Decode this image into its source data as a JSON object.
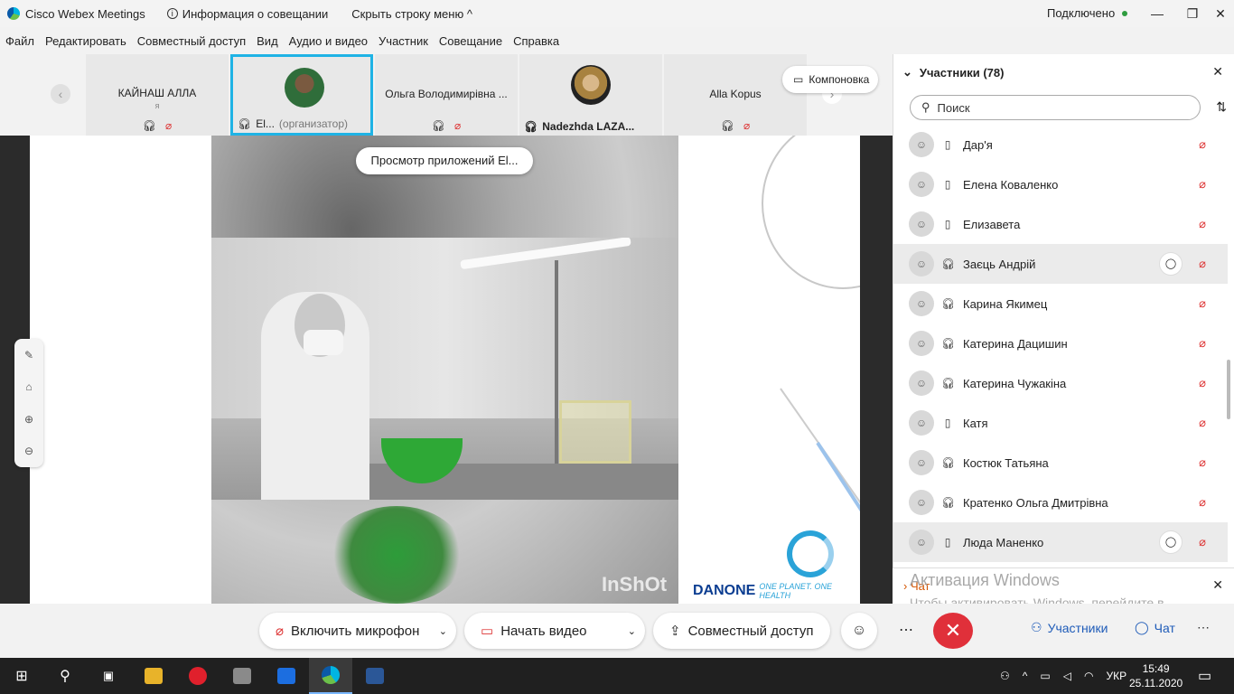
{
  "app": {
    "title": "Cisco Webex Meetings",
    "meeting_info": "Информация о совещании",
    "hide_menu": "Скрыть строку меню ^",
    "status": "Подключено"
  },
  "window_controls": {
    "minimize": "—",
    "restore": "❐",
    "close": "✕"
  },
  "menu": [
    "Файл",
    "Редактировать",
    "Совместный доступ",
    "Вид",
    "Аудио и видео",
    "Участник",
    "Совещание",
    "Справка"
  ],
  "strip": {
    "tiles": [
      {
        "name": "КАЙНАШ АЛЛА",
        "sub": "я"
      },
      {
        "name": "El...",
        "role": "(организатор)"
      },
      {
        "name": "Ольга Володимирівна ..."
      },
      {
        "name": "Nadezhda LAZA..."
      },
      {
        "name": "Alla Kopus"
      }
    ],
    "layout_label": "Компоновка"
  },
  "share": {
    "preview_label": "Просмотр приложений El...",
    "watermark": "InShOt",
    "brand": "DANONE",
    "tagline": "ONE PLANET. ONE HEALTH"
  },
  "participants": {
    "title": "Участники (78)",
    "search_placeholder": "Поиск",
    "list": [
      {
        "name": "Дар'я",
        "device": "phone",
        "chat": false
      },
      {
        "name": "Елена Коваленко",
        "device": "phone",
        "chat": false
      },
      {
        "name": "Елизавета",
        "device": "phone",
        "chat": false
      },
      {
        "name": "Заєць Андрій",
        "device": "headset",
        "chat": true
      },
      {
        "name": "Карина Якимец",
        "device": "headset",
        "chat": false
      },
      {
        "name": "Катерина Дацишин",
        "device": "headset",
        "chat": false
      },
      {
        "name": "Катерина Чужакіна",
        "device": "headset",
        "chat": false
      },
      {
        "name": "Катя",
        "device": "phone",
        "chat": false
      },
      {
        "name": "Костюк Татьяна",
        "device": "headset",
        "chat": false
      },
      {
        "name": "Кратенко Ольга Дмитрівна",
        "device": "headset",
        "chat": false
      },
      {
        "name": "Люда Маненко",
        "device": "phone",
        "chat": true
      }
    ]
  },
  "chat_panel": {
    "label": "Чат"
  },
  "activation": {
    "title": "Активация Windows",
    "text": "Чтобы активировать Windows, перейдите в раздел \"Параметры\"."
  },
  "controls": {
    "mic": "Включить микрофон",
    "video": "Начать видео",
    "share": "Совместный доступ",
    "participants": "Участники",
    "chat": "Чат"
  },
  "taskbar": {
    "lang": "УКР",
    "time": "15:49",
    "date": "25.11.2020"
  }
}
